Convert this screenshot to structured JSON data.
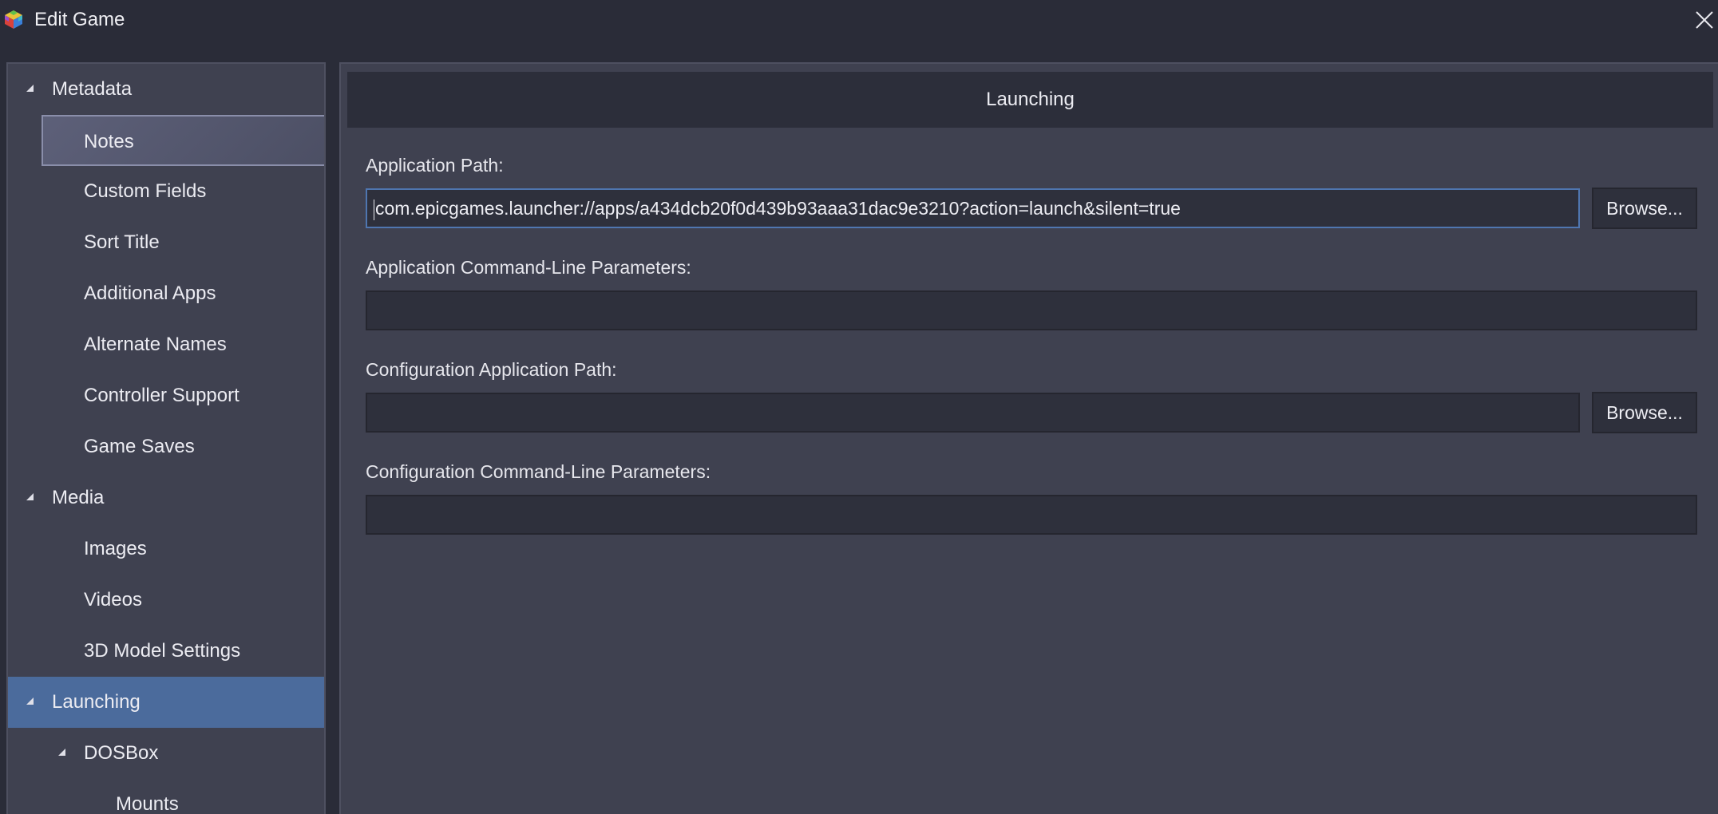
{
  "window": {
    "title": "Edit Game",
    "icon": "launchbox-cube-icon",
    "close_icon": "close-icon"
  },
  "sidebar": {
    "items": [
      {
        "label": "Metadata",
        "level": 0,
        "expanded": true
      },
      {
        "label": "Notes",
        "level": 1,
        "state": "hover"
      },
      {
        "label": "Custom Fields",
        "level": 1
      },
      {
        "label": "Sort Title",
        "level": 1
      },
      {
        "label": "Additional Apps",
        "level": 1
      },
      {
        "label": "Alternate Names",
        "level": 1
      },
      {
        "label": "Controller Support",
        "level": 1
      },
      {
        "label": "Game Saves",
        "level": 1
      },
      {
        "label": "Media",
        "level": 0,
        "expanded": true
      },
      {
        "label": "Images",
        "level": 1
      },
      {
        "label": "Videos",
        "level": 1
      },
      {
        "label": "3D Model Settings",
        "level": 1
      },
      {
        "label": "Launching",
        "level": 0,
        "expanded": true,
        "state": "selected"
      },
      {
        "label": "DOSBox",
        "level": 1,
        "expanded": true
      },
      {
        "label": "Mounts",
        "level": 2
      }
    ]
  },
  "main": {
    "section_title": "Launching",
    "fields": {
      "app_path": {
        "label": "Application Path:",
        "value": "com.epicgames.launcher://apps/a434dcb20f0d439b93aaa31dac9e3210?action=launch&silent=true",
        "browse_label": "Browse..."
      },
      "app_params": {
        "label": "Application Command-Line Parameters:",
        "value": ""
      },
      "config_path": {
        "label": "Configuration Application Path:",
        "value": "",
        "browse_label": "Browse..."
      },
      "config_params": {
        "label": "Configuration Command-Line Parameters:",
        "value": ""
      }
    }
  },
  "colors": {
    "background": "#2a2c38",
    "panel": "#3f4150",
    "input": "#2e303c",
    "selected": "#4b6b9c",
    "focus_border": "#4f76b0"
  }
}
